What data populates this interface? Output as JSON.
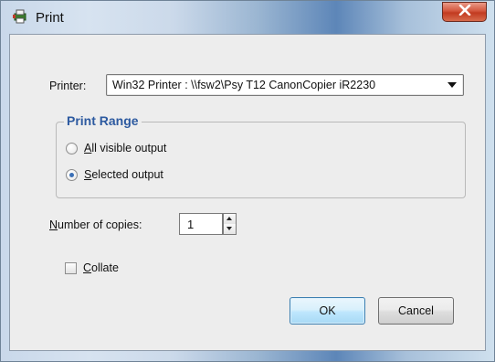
{
  "window": {
    "title": "Print"
  },
  "printer": {
    "label": "Printer:",
    "selected": "Win32 Printer : \\\\fsw2\\Psy T12 CanonCopier iR2230"
  },
  "print_range": {
    "title": "Print Range",
    "options": [
      {
        "label_first": "A",
        "label_rest": "ll visible output",
        "checked": false
      },
      {
        "label_first": "S",
        "label_rest": "elected output",
        "checked": true
      }
    ]
  },
  "copies": {
    "label_first": "N",
    "label_rest": "umber of copies:",
    "value": "1"
  },
  "collate": {
    "label_first": "C",
    "label_rest": "ollate",
    "checked": false
  },
  "buttons": {
    "ok": "OK",
    "cancel": "Cancel"
  },
  "colors": {
    "group_title": "#2d5aa0",
    "radio_dot": "#3b6fb6",
    "close_button": "#c23a20"
  }
}
